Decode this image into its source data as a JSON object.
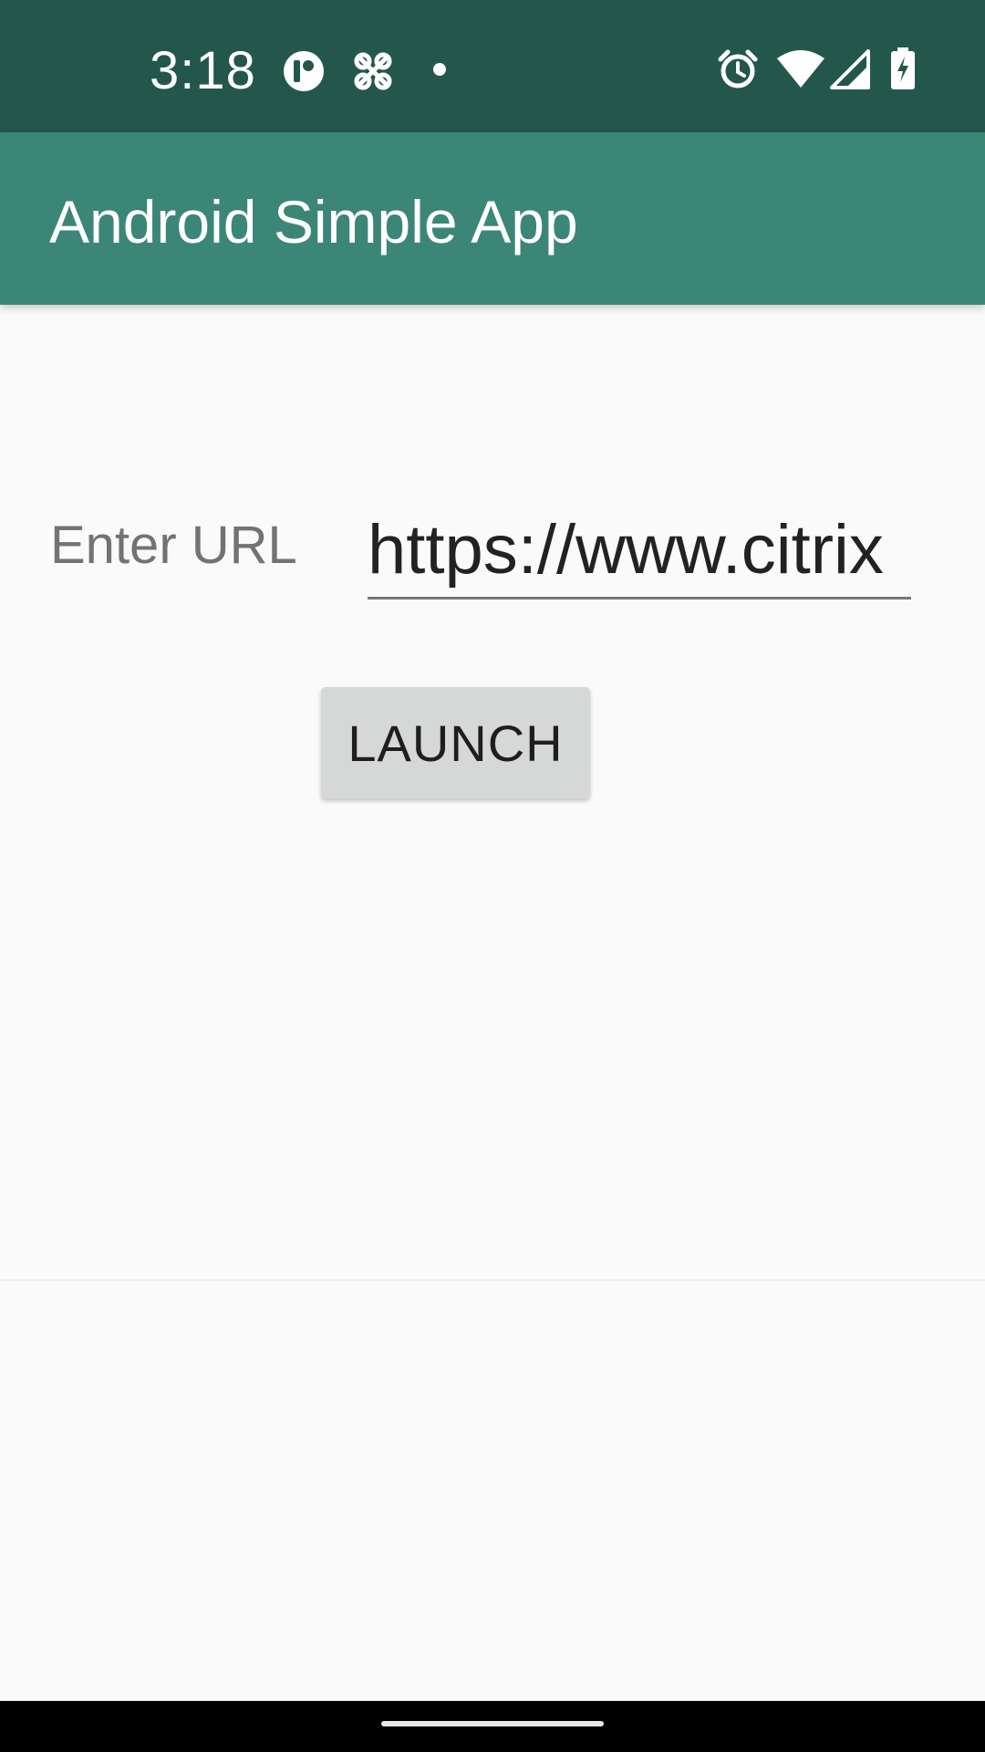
{
  "status_bar": {
    "time": "3:18",
    "icons": [
      "notification-p-icon",
      "notification-app-icon",
      "dot-icon",
      "alarm-icon",
      "wifi-icon",
      "cell-signal-icon",
      "battery-charging-icon"
    ]
  },
  "app_bar": {
    "title": "Android Simple App"
  },
  "form": {
    "url_label": "Enter URL",
    "url_value": "https://www.citrix",
    "launch_label": "LAUNCH"
  },
  "colors": {
    "status_bar": "#24574b",
    "app_bar": "#3c8677",
    "background": "#fafafa",
    "button": "#d6d7d7"
  }
}
